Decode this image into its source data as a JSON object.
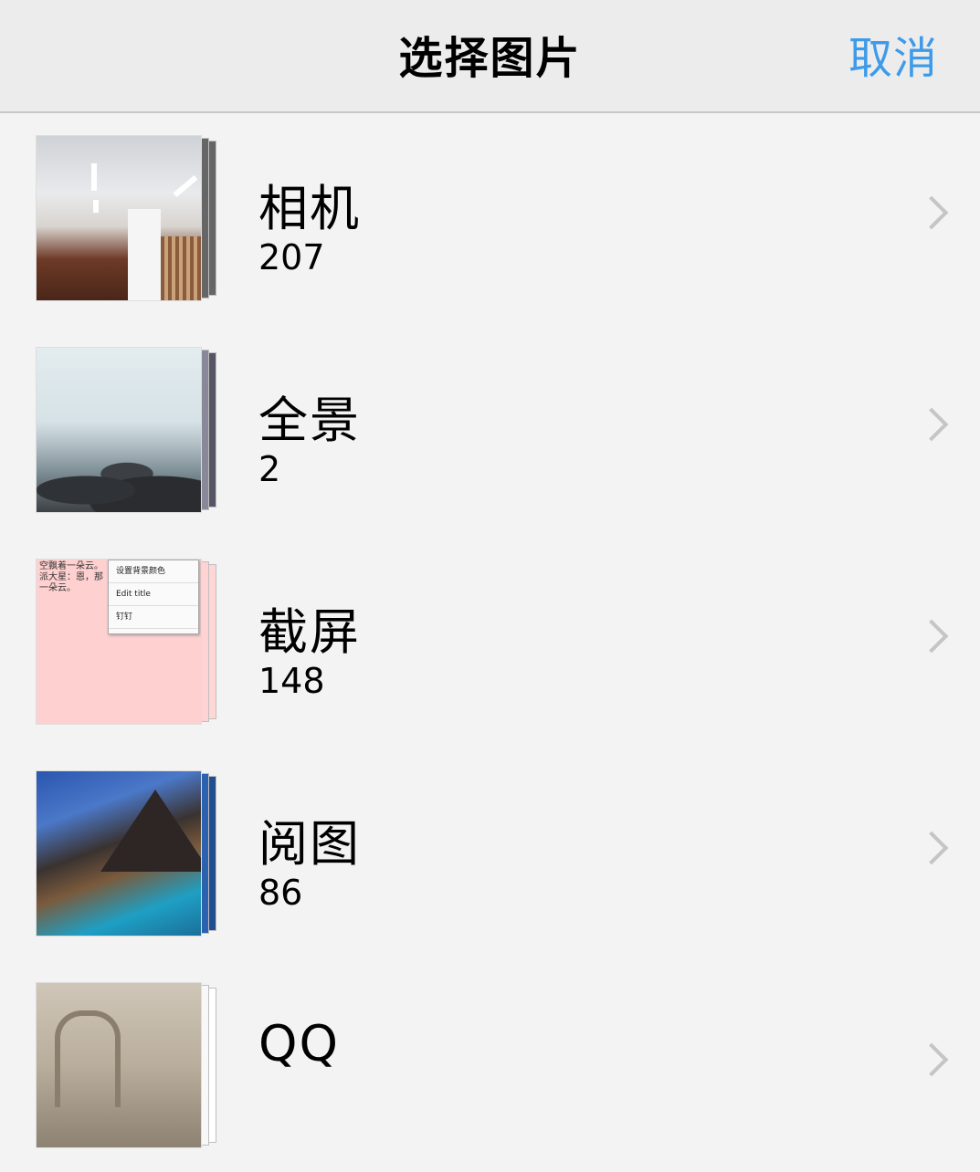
{
  "navbar": {
    "title": "选择图片",
    "cancel_label": "取消"
  },
  "albums": [
    {
      "name": "相机",
      "count": "207"
    },
    {
      "name": "全景",
      "count": "2"
    },
    {
      "name": "截屏",
      "count": "148",
      "thumb_text": "空飘着一朵云。派大星：恩，那一朵云。",
      "thumb_menu": [
        "设置背景颜色",
        "Edit title",
        "钉钉"
      ]
    },
    {
      "name": "阅图",
      "count": "86"
    },
    {
      "name": "QQ"
    }
  ],
  "colors": {
    "accent": "#3d9be9",
    "navbar_bg": "#ececec",
    "page_bg": "#f3f3f3"
  },
  "icons": {
    "row_arrow": "chevron-right-icon"
  }
}
